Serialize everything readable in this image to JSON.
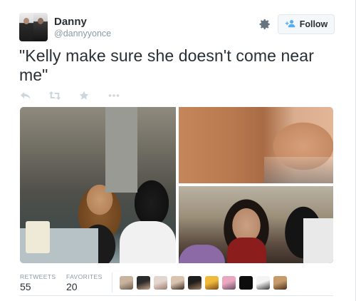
{
  "tweet": {
    "author_name": "Danny",
    "author_handle": "@dannyyonce",
    "follow_label": "Follow",
    "text": "\"Kelly make sure she doesn't come near me\""
  },
  "icons": {
    "reply": "reply-icon",
    "retweet": "retweet-icon",
    "favorite": "star-icon",
    "more": "more-dots-icon",
    "settings": "gear-icon",
    "follow": "add-user-icon"
  },
  "stats": {
    "retweets_label": "RETWEETS",
    "retweets_count": "55",
    "favorites_label": "FAVORITES",
    "favorites_count": "20"
  },
  "favoriters": [
    {
      "color_a": "#c8b49e",
      "color_b": "#6b5a4e"
    },
    {
      "color_a": "#2b2b2b",
      "color_b": "#c9a58a"
    },
    {
      "color_a": "#e3d6cf",
      "color_b": "#9c7a6a"
    },
    {
      "color_a": "#d9c2b0",
      "color_b": "#3b2a22"
    },
    {
      "color_a": "#1e1e1e",
      "color_b": "#a57f60"
    },
    {
      "color_a": "#f0b93a",
      "color_b": "#7a4b1a"
    },
    {
      "color_a": "#e9a8c0",
      "color_b": "#6a4d62"
    },
    {
      "color_a": "#0d0d0d",
      "color_b": "#0d0d0d"
    },
    {
      "color_a": "#f4f4f4",
      "color_b": "#3a3a3a"
    },
    {
      "color_a": "#c79a6a",
      "color_b": "#4a2f1c"
    }
  ],
  "colors": {
    "text": "#292f33",
    "muted": "#8899a6",
    "border": "#e1e8ed",
    "follow_icon": "#55acee"
  }
}
